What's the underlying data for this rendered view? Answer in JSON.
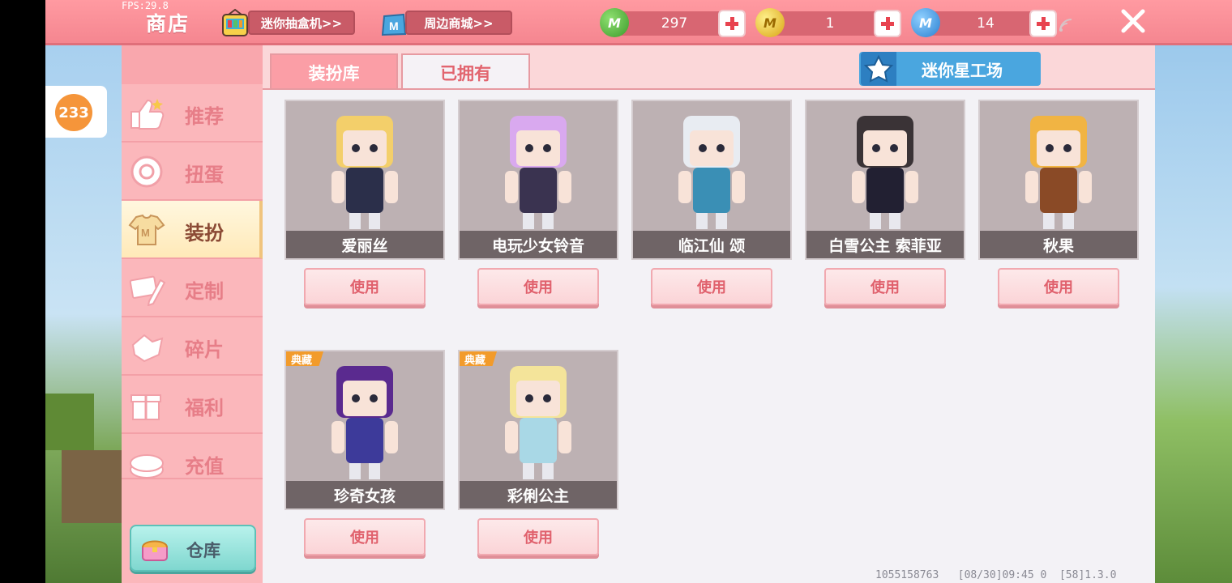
{
  "fps": "FPS:29.8",
  "header": {
    "title": "商店",
    "lootbox_label": "迷你抽盒机>>",
    "merch_label": "周边商城>>",
    "currencies": [
      {
        "icon": "green-gem-icon",
        "value": "297",
        "color": "#4fb63a"
      },
      {
        "icon": "gold-m-coin-icon",
        "value": "1",
        "color": "#f1c21d"
      },
      {
        "icon": "blue-m-coin-icon",
        "value": "14",
        "color": "#3f9ae2"
      }
    ]
  },
  "badge_count": "233",
  "sidebar": {
    "items": [
      {
        "label": "推荐",
        "icon": "thumbs-up-icon"
      },
      {
        "label": "扭蛋",
        "icon": "capsule-icon"
      },
      {
        "label": "装扮",
        "icon": "shirt-icon"
      },
      {
        "label": "定制",
        "icon": "pencil-ruler-icon"
      },
      {
        "label": "碎片",
        "icon": "fragment-icon"
      },
      {
        "label": "福利",
        "icon": "gift-icon"
      },
      {
        "label": "充值",
        "icon": "recharge-icon"
      }
    ],
    "active": "装扮",
    "warehouse_label": "仓库"
  },
  "tabs": [
    {
      "label": "装扮库",
      "active": false
    },
    {
      "label": "已拥有",
      "active": true
    }
  ],
  "studio_label": "迷你星工场",
  "skins": [
    {
      "name": "爱丽丝",
      "tag": "",
      "use_label": "使用",
      "hair": "#f3cf6a",
      "outfit": "#2b2f4a"
    },
    {
      "name": "电玩少女铃音",
      "tag": "",
      "use_label": "使用",
      "hair": "#d9a9ef",
      "outfit": "#3a3350"
    },
    {
      "name": "临江仙 颂",
      "tag": "",
      "use_label": "使用",
      "hair": "#e8ecf2",
      "outfit": "#3a8fb5"
    },
    {
      "name": "白雪公主 索菲亚",
      "tag": "",
      "use_label": "使用",
      "hair": "#3a3336",
      "outfit": "#222032"
    },
    {
      "name": "秋果",
      "tag": "",
      "use_label": "使用",
      "hair": "#f1b443",
      "outfit": "#8a4a26"
    },
    {
      "name": "珍奇女孩",
      "tag": "典藏",
      "use_label": "使用",
      "hair": "#5a2a8f",
      "outfit": "#3d3a9a"
    },
    {
      "name": "彩俐公主",
      "tag": "典藏",
      "use_label": "使用",
      "hair": "#f4e49a",
      "outfit": "#a9d8e6"
    }
  ],
  "footer": "1055158763   [08/30]09:45 0  [58]1.3.0"
}
